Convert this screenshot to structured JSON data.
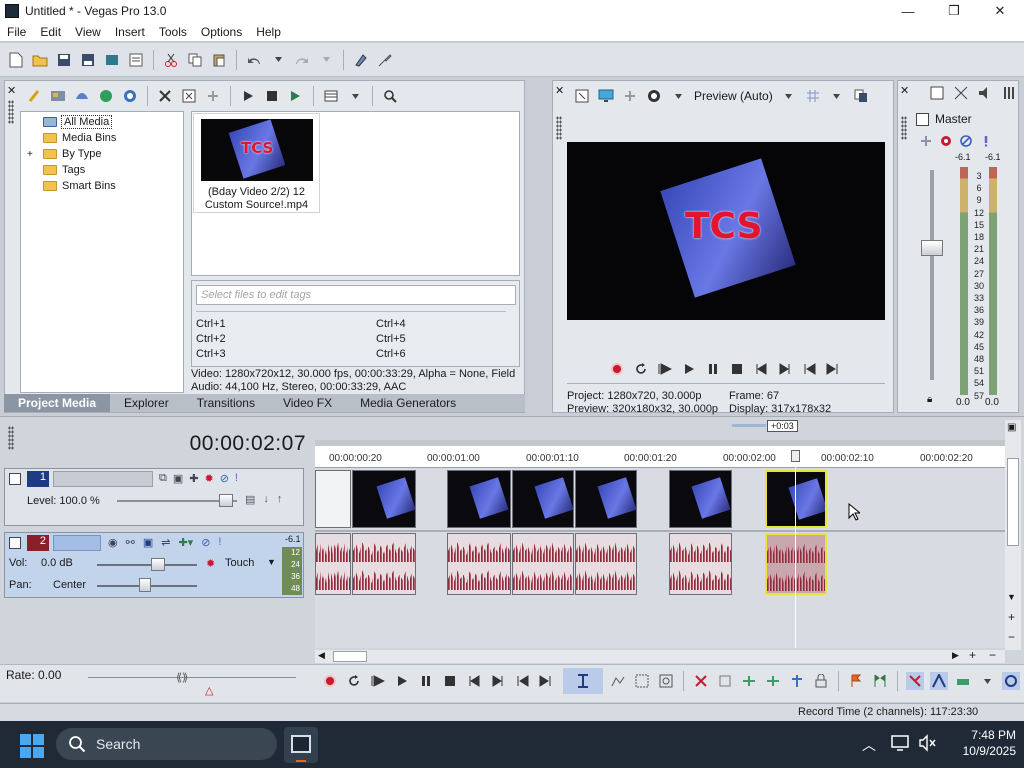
{
  "window": {
    "title": "Untitled * - Vegas Pro 13.0",
    "minimize": "—",
    "restore": "❐",
    "close": "✕"
  },
  "menu": [
    "File",
    "Edit",
    "View",
    "Insert",
    "Tools",
    "Options",
    "Help"
  ],
  "project_media": {
    "tree": [
      {
        "label": "All Media",
        "selected": true
      },
      {
        "label": "Media Bins"
      },
      {
        "label": "By Type",
        "expand": "+"
      },
      {
        "label": "Tags"
      },
      {
        "label": "Smart Bins"
      }
    ],
    "thumbnail_label": "(Bday Video 2/2) 12 Custom Source!.mp4",
    "tag_placeholder": "Select files to edit tags",
    "shortcuts": [
      "Ctrl+1",
      "Ctrl+4",
      "Ctrl+2",
      "Ctrl+5",
      "Ctrl+3",
      "Ctrl+6"
    ],
    "info_video": "Video: 1280x720x12, 30.000 fps, 00:00:33:29, Alpha = None, Field",
    "info_audio": "Audio: 44,100 Hz, Stereo, 00:00:33:29, AAC",
    "tabs": [
      "Project Media",
      "Explorer",
      "Transitions",
      "Video FX",
      "Media Generators"
    ],
    "thumb_text": "TCS"
  },
  "preview": {
    "quality": "Preview (Auto)",
    "project": "Project:  1280x720, 30.000p",
    "preview": "Preview:  320x180x32, 30.000p",
    "frame": "Frame:    67",
    "display": "Display:   317x178x32",
    "frame_text": "TCS"
  },
  "master": {
    "title": "Master",
    "peak_left": "-6.1",
    "peak_right": "-6.1",
    "scale": [
      "3",
      "6",
      "9",
      "12",
      "15",
      "18",
      "21",
      "24",
      "27",
      "30",
      "33",
      "36",
      "39",
      "42",
      "45",
      "48",
      "51",
      "54",
      "57"
    ],
    "level_left": "0.0",
    "level_right": "0.0"
  },
  "timeline": {
    "timecode": "00:00:02:07",
    "loop_label": "+0:03",
    "ruler": [
      "00:00:00:20",
      "00:00:01:00",
      "00:00:01:10",
      "00:00:01:20",
      "00:00:02:00",
      "00:00:02:10",
      "00:00:02:20"
    ],
    "video_track": {
      "number": "1",
      "level": "Level: 100.0 %"
    },
    "audio_track": {
      "number": "2",
      "vol": "Vol:",
      "vol_value": "0.0 dB",
      "pan": "Pan:",
      "pan_value": "Center",
      "mode": "Touch",
      "peak": "-6.1",
      "meter_scale": [
        "12",
        "24",
        "36",
        "48"
      ]
    },
    "rate": "Rate: 0.00",
    "record_time": "Record Time (2 channels): 117:23:30"
  },
  "taskbar": {
    "search": "Search",
    "time": "7:48 PM",
    "date": "10/9/2025"
  },
  "colors": {
    "accent": "#3b6fbf",
    "selection_yellow": "#e7e43a",
    "tab_active": "#8b95a3",
    "taskbar": "#1f2a36"
  }
}
